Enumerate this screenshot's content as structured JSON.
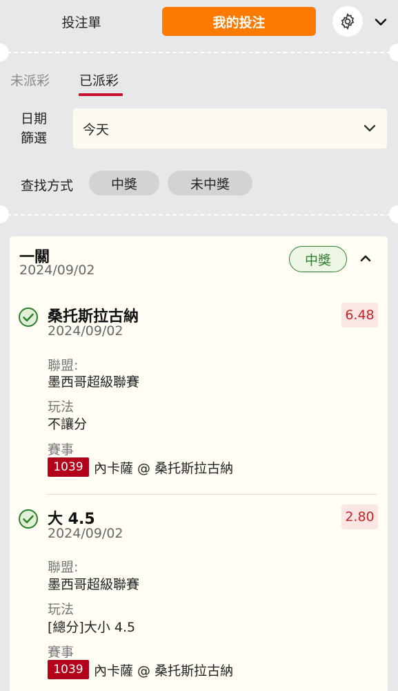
{
  "header": {
    "bet_slip_tab": "投注單",
    "my_bets_tab": "我的投注",
    "settings_icon": "gear-icon",
    "expand_icon": "chevron-down-icon"
  },
  "filters": {
    "status_tabs": [
      {
        "label": "未派彩",
        "active": false
      },
      {
        "label": "已派彩",
        "active": true
      }
    ],
    "date_label": "日期\n篩選",
    "date_value": "今天",
    "find_label": "查找方式",
    "find_options": [
      "中獎",
      "未中獎"
    ]
  },
  "bet": {
    "type": "一關",
    "date": "2024/09/02",
    "result_badge": "中獎",
    "selections": [
      {
        "name": "桑托斯拉古納",
        "date": "2024/09/02",
        "odds": "6.48",
        "league_label": "聯盟:",
        "league": "墨西哥超級聯賽",
        "market_label": "玩法",
        "market": "不讓分",
        "event_label": "賽事",
        "event_code": "1039",
        "event_teams": "內卡薩 @ 桑托斯拉古納"
      },
      {
        "name": "大 4.5",
        "date": "2024/09/02",
        "odds": "2.80",
        "league_label": "聯盟:",
        "league": "墨西哥超級聯賽",
        "market_label": "玩法",
        "market": "[總分]大小 4.5",
        "event_label": "賽事",
        "event_code": "1039",
        "event_teams": "內卡薩 @ 桑托斯拉古納"
      }
    ]
  },
  "colors": {
    "accent_orange": "#ff7a00",
    "active_underline": "#c8102e",
    "win_green": "#2d7d2d",
    "odds_red": "#c1272d",
    "event_code_bg": "#b3001b"
  }
}
